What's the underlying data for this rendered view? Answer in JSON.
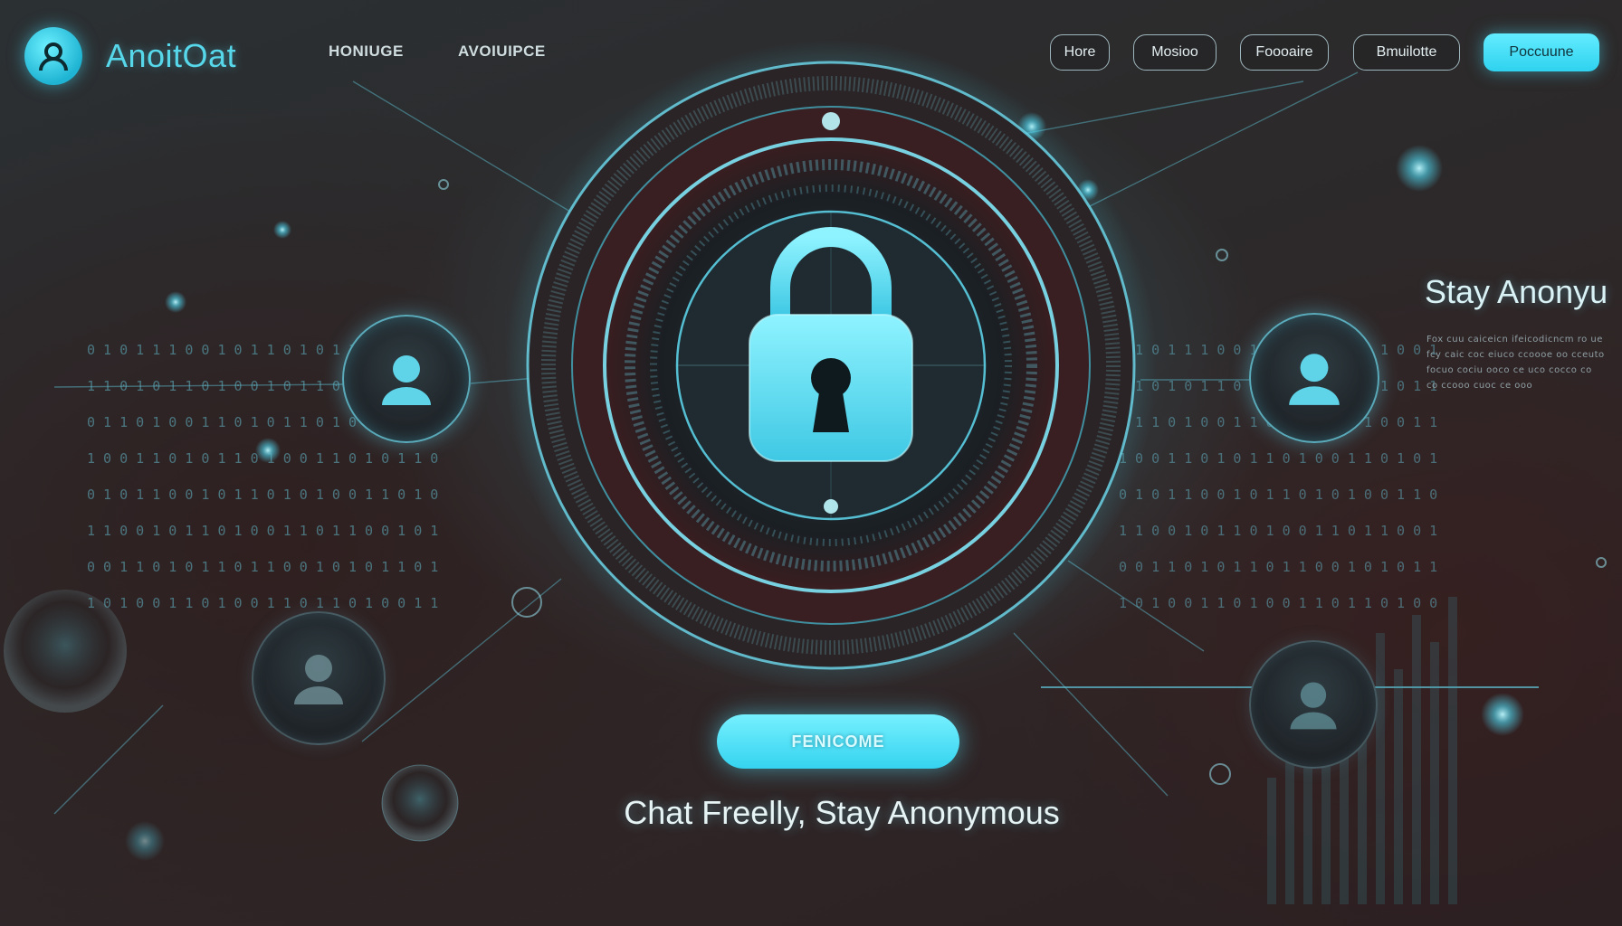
{
  "header": {
    "app_name": "AnoitOat",
    "top_links": [
      "HONIUGE",
      "AVOIUIPCE"
    ],
    "nav": [
      "Hore",
      "Mosioo",
      "Foooaire",
      "Bmuilotte"
    ],
    "cta": "Poccuune"
  },
  "hero": {
    "icon": "padlock-icon",
    "button_label": "FENICOME",
    "tagline": "Chat Freelly, Stay Anonymous"
  },
  "side_panel": {
    "title": "Stay Anonyu",
    "lines": [
      "Fox cuu caiceicn ifeicodicncm ro ue",
      "fcy caic coc eiuco ccoooe oo cceuto",
      "focuo cociu ooco ce uco cocco co",
      "co ccooo cuoc ce ooo"
    ]
  },
  "decor": {
    "accent_color": "#46dcf5",
    "binary_rows": [
      "0 1 0 1 1 1 0 0 1 0 1 1 0 1 0 1 1 0 0 1 0 1",
      "1 1 0 1 0 1 1 0 1 0 0 1 0 1 1 0 1 0 1 1 0 0",
      "0 1 1 0 1 0 0 1 1 0 1 0 1 1 0 1 0 0 1 1 0 1",
      "1 0 0 1 1 0 1 0 1 1 0 1 0 0 1 1 0 1 0 1 1 0",
      "0 1 0 1 1 0 0 1 0 1 1 0 1 0 1 0 0 1 1 0 1 0",
      "1 1 0 0 1 0 1 1 0 1 0 0 1 1 0 1 1 0 0 1 0 1",
      "0 0 1 1 0 1 0 1 1 0 1 1 0 0 1 0 1 0 1 1 0 1",
      "1 0 1 0 0 1 1 0 1 0 0 1 1 0 1 1 0 1 0 0 1 1"
    ]
  }
}
